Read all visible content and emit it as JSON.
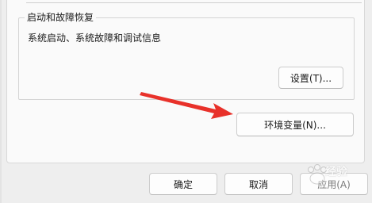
{
  "startup_recovery": {
    "title": "启动和故障恢复",
    "description": "系统启动、系统故障和调试信息",
    "settings_label": "设置(T)..."
  },
  "env_vars_label": "环境变量(N)...",
  "dialog_buttons": {
    "ok_label": "确定",
    "cancel_label": "取消",
    "apply_label": "应用(A)"
  },
  "watermark": {
    "text": "经验"
  },
  "colors": {
    "arrow": "#e8312a"
  }
}
